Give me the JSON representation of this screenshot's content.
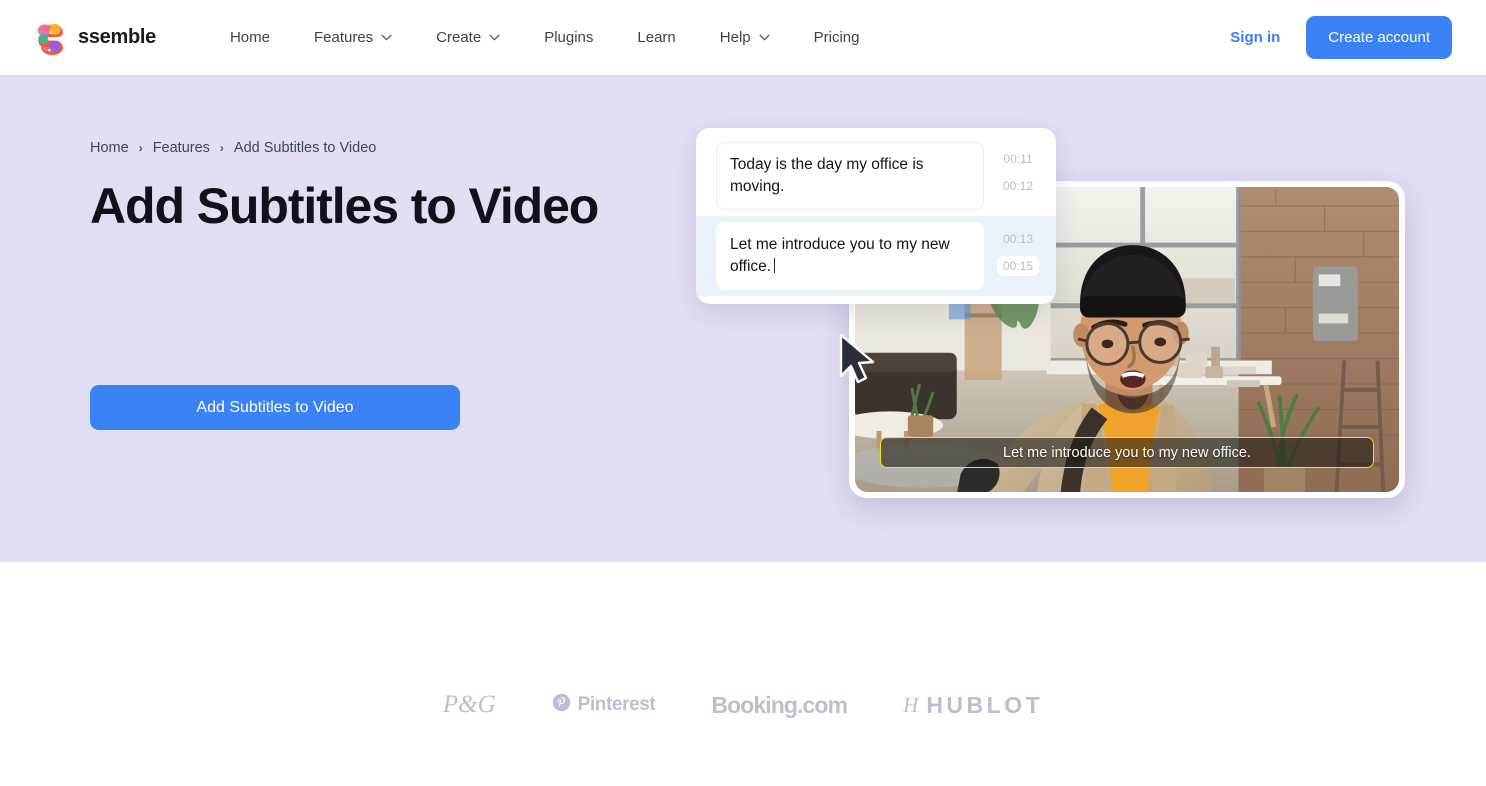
{
  "nav": {
    "brand": {
      "name": "ssemble",
      "logo_icon": "ssemble-logo-icon"
    },
    "links": [
      {
        "label": "Home",
        "has_dropdown": false
      },
      {
        "label": "Features",
        "has_dropdown": true
      },
      {
        "label": "Create",
        "has_dropdown": true
      },
      {
        "label": "Plugins",
        "has_dropdown": false
      },
      {
        "label": "Learn",
        "has_dropdown": false
      },
      {
        "label": "Help",
        "has_dropdown": true
      },
      {
        "label": "Pricing",
        "has_dropdown": false
      }
    ],
    "sign_in": "Sign in",
    "create_account": "Create account"
  },
  "hero": {
    "breadcrumb": [
      {
        "label": "Home"
      },
      {
        "label": "Features"
      },
      {
        "label": "Add Subtitles to Video"
      }
    ],
    "breadcrumb_separator": "›",
    "title": "Add Subtitles to Video",
    "cta_label": "Add Subtitles to Video",
    "background_color": "#E2DEF4"
  },
  "subtitle_editor": {
    "rows": [
      {
        "text": "Today is the day my office is moving.",
        "start": "00:11",
        "end": "00:12",
        "active": false
      },
      {
        "text": "Let me introduce you to my new office.",
        "start": "00:13",
        "end": "00:15",
        "active": true
      }
    ]
  },
  "video": {
    "caption": "Let me introduce you to my new office.",
    "caption_border_color": "#F2E500",
    "cursor_icon": "mouse-pointer-icon"
  },
  "logos": {
    "heading": "",
    "items": [
      {
        "name": "P&G",
        "type": "pg"
      },
      {
        "name": "Pinterest",
        "type": "pinterest"
      },
      {
        "name": "Booking.com",
        "type": "booking"
      },
      {
        "name": "HUBLOT",
        "type": "hublot"
      }
    ]
  },
  "colors": {
    "accent_blue": "#3b82f6",
    "hero_bg": "#E2DEF4",
    "active_row": "#EAF0FC",
    "caption_yellow": "#F2E500"
  }
}
